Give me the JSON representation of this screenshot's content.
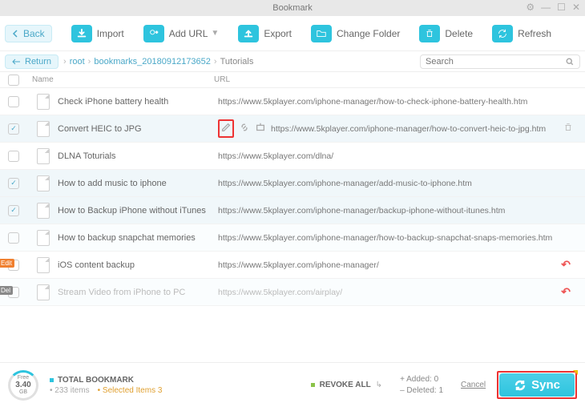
{
  "window": {
    "title": "Bookmark"
  },
  "toolbar": {
    "back": "Back",
    "import": "Import",
    "add_url": "Add URL",
    "export": "Export",
    "change_folder": "Change Folder",
    "delete": "Delete",
    "refresh": "Refresh"
  },
  "breadcrumb": {
    "return": "Return",
    "root": "root",
    "folder": "bookmarks_20180912173652",
    "current": "Tutorials"
  },
  "search": {
    "placeholder": "Search"
  },
  "columns": {
    "name": "Name",
    "url": "URL"
  },
  "rows": [
    {
      "checked": false,
      "name": "Check iPhone battery health",
      "url": "https://www.5kplayer.com/iphone-manager/how-to-check-iphone-battery-health.htm"
    },
    {
      "checked": true,
      "name": "Convert HEIC to JPG",
      "url": "https://www.5kplayer.com/iphone-manager/how-to-convert-heic-to-jpg.htm",
      "actions": true,
      "highlight_edit": true,
      "trash": true
    },
    {
      "checked": false,
      "name": "DLNA Toturials",
      "url": "https://www.5kplayer.com/dlna/"
    },
    {
      "checked": true,
      "name": "How to add music to iphone",
      "url": "https://www.5kplayer.com/iphone-manager/add-music-to-iphone.htm"
    },
    {
      "checked": true,
      "name": "How to Backup iPhone without iTunes",
      "url": "https://www.5kplayer.com/iphone-manager/backup-iphone-without-itunes.htm"
    },
    {
      "checked": false,
      "name": "How to backup snapchat memories",
      "url": "https://www.5kplayer.com/iphone-manager/how-to-backup-snapchat-snaps-memories.htm"
    },
    {
      "checked": false,
      "name": "iOS content backup",
      "url": "https://www.5kplayer.com/iphone-manager/",
      "badge": "Edit",
      "badge_cls": "badge-edit",
      "undo": true
    },
    {
      "checked": false,
      "name": "Stream Video from iPhone to PC",
      "url": "https://www.5kplayer.com/airplay/",
      "badge": "Del",
      "badge_cls": "badge-del",
      "undo": true,
      "disabled": true
    }
  ],
  "footer": {
    "free_label": "Free",
    "free_value": "3.40",
    "free_unit": "GB",
    "total_label": "TOTAL BOOKMARK",
    "items_text": "233 items",
    "selected_text": "Selected Items 3",
    "revoke": "REVOKE ALL",
    "added_label": "Added:",
    "added_value": "0",
    "deleted_label": "Deleted:",
    "deleted_value": "1",
    "cancel": "Cancel",
    "sync": "Sync"
  }
}
